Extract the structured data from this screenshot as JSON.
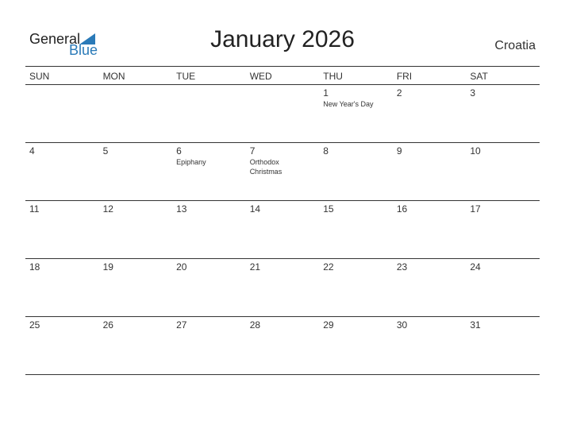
{
  "logo": {
    "general": "General",
    "blue": "Blue"
  },
  "title": "January 2026",
  "country": "Croatia",
  "weekdays": [
    "SUN",
    "MON",
    "TUE",
    "WED",
    "THU",
    "FRI",
    "SAT"
  ],
  "weeks": [
    [
      {
        "d": "",
        "e": ""
      },
      {
        "d": "",
        "e": ""
      },
      {
        "d": "",
        "e": ""
      },
      {
        "d": "",
        "e": ""
      },
      {
        "d": "1",
        "e": "New Year's Day"
      },
      {
        "d": "2",
        "e": ""
      },
      {
        "d": "3",
        "e": ""
      }
    ],
    [
      {
        "d": "4",
        "e": ""
      },
      {
        "d": "5",
        "e": ""
      },
      {
        "d": "6",
        "e": "Epiphany"
      },
      {
        "d": "7",
        "e": "Orthodox Christmas"
      },
      {
        "d": "8",
        "e": ""
      },
      {
        "d": "9",
        "e": ""
      },
      {
        "d": "10",
        "e": ""
      }
    ],
    [
      {
        "d": "11",
        "e": ""
      },
      {
        "d": "12",
        "e": ""
      },
      {
        "d": "13",
        "e": ""
      },
      {
        "d": "14",
        "e": ""
      },
      {
        "d": "15",
        "e": ""
      },
      {
        "d": "16",
        "e": ""
      },
      {
        "d": "17",
        "e": ""
      }
    ],
    [
      {
        "d": "18",
        "e": ""
      },
      {
        "d": "19",
        "e": ""
      },
      {
        "d": "20",
        "e": ""
      },
      {
        "d": "21",
        "e": ""
      },
      {
        "d": "22",
        "e": ""
      },
      {
        "d": "23",
        "e": ""
      },
      {
        "d": "24",
        "e": ""
      }
    ],
    [
      {
        "d": "25",
        "e": ""
      },
      {
        "d": "26",
        "e": ""
      },
      {
        "d": "27",
        "e": ""
      },
      {
        "d": "28",
        "e": ""
      },
      {
        "d": "29",
        "e": ""
      },
      {
        "d": "30",
        "e": ""
      },
      {
        "d": "31",
        "e": ""
      }
    ]
  ]
}
